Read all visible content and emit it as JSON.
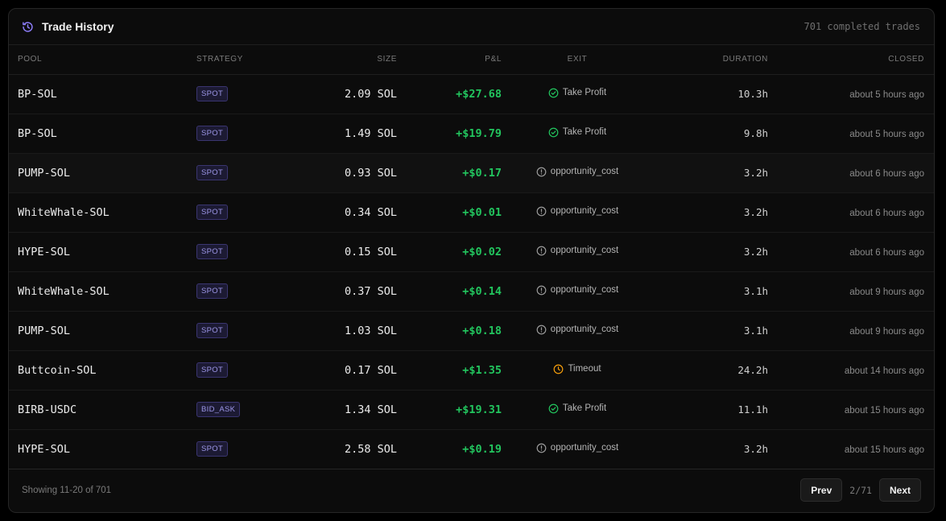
{
  "header": {
    "title": "Trade History",
    "count": "701 completed trades",
    "icon": "history-icon",
    "icon_color": "#8b7cf6"
  },
  "columns": {
    "pool": "POOL",
    "strategy": "STRATEGY",
    "size": "SIZE",
    "pnl": "P&L",
    "exit": "EXIT",
    "duration": "DURATION",
    "closed": "CLOSED"
  },
  "rows": [
    {
      "pool": "BP-SOL",
      "strategy": "SPOT",
      "size": "2.09 SOL",
      "pnl": "+$27.68",
      "exit": "Take Profit",
      "exit_icon": "check-circle-icon",
      "duration": "10.3h",
      "closed": "about 5 hours ago"
    },
    {
      "pool": "BP-SOL",
      "strategy": "SPOT",
      "size": "1.49 SOL",
      "pnl": "+$19.79",
      "exit": "Take Profit",
      "exit_icon": "check-circle-icon",
      "duration": "9.8h",
      "closed": "about 5 hours ago"
    },
    {
      "pool": "PUMP-SOL",
      "strategy": "SPOT",
      "size": "0.93 SOL",
      "pnl": "+$0.17",
      "exit": "opportunity_cost",
      "exit_icon": "alert-circle-icon",
      "duration": "3.2h",
      "closed": "about 6 hours ago"
    },
    {
      "pool": "WhiteWhale-SOL",
      "strategy": "SPOT",
      "size": "0.34 SOL",
      "pnl": "+$0.01",
      "exit": "opportunity_cost",
      "exit_icon": "alert-circle-icon",
      "duration": "3.2h",
      "closed": "about 6 hours ago"
    },
    {
      "pool": "HYPE-SOL",
      "strategy": "SPOT",
      "size": "0.15 SOL",
      "pnl": "+$0.02",
      "exit": "opportunity_cost",
      "exit_icon": "alert-circle-icon",
      "duration": "3.2h",
      "closed": "about 6 hours ago"
    },
    {
      "pool": "WhiteWhale-SOL",
      "strategy": "SPOT",
      "size": "0.37 SOL",
      "pnl": "+$0.14",
      "exit": "opportunity_cost",
      "exit_icon": "alert-circle-icon",
      "duration": "3.1h",
      "closed": "about 9 hours ago"
    },
    {
      "pool": "PUMP-SOL",
      "strategy": "SPOT",
      "size": "1.03 SOL",
      "pnl": "+$0.18",
      "exit": "opportunity_cost",
      "exit_icon": "alert-circle-icon",
      "duration": "3.1h",
      "closed": "about 9 hours ago"
    },
    {
      "pool": "Buttcoin-SOL",
      "strategy": "SPOT",
      "size": "0.17 SOL",
      "pnl": "+$1.35",
      "exit": "Timeout",
      "exit_icon": "clock-icon",
      "duration": "24.2h",
      "closed": "about 14 hours ago"
    },
    {
      "pool": "BIRB-USDC",
      "strategy": "BID_ASK",
      "size": "1.34 SOL",
      "pnl": "+$19.31",
      "exit": "Take Profit",
      "exit_icon": "check-circle-icon",
      "duration": "11.1h",
      "closed": "about 15 hours ago"
    },
    {
      "pool": "HYPE-SOL",
      "strategy": "SPOT",
      "size": "2.58 SOL",
      "pnl": "+$0.19",
      "exit": "opportunity_cost",
      "exit_icon": "alert-circle-icon",
      "duration": "3.2h",
      "closed": "about 15 hours ago"
    }
  ],
  "colors": {
    "pnl_positive": "#22c55e",
    "take_profit": "#22c55e",
    "opportunity_cost": "#9a9a9a",
    "timeout": "#f59e0b",
    "badge_text": "#9d97e8"
  },
  "footer": {
    "showing": "Showing 11-20 of 701",
    "prev_label": "Prev",
    "page_indicator": "2/71",
    "next_label": "Next"
  }
}
